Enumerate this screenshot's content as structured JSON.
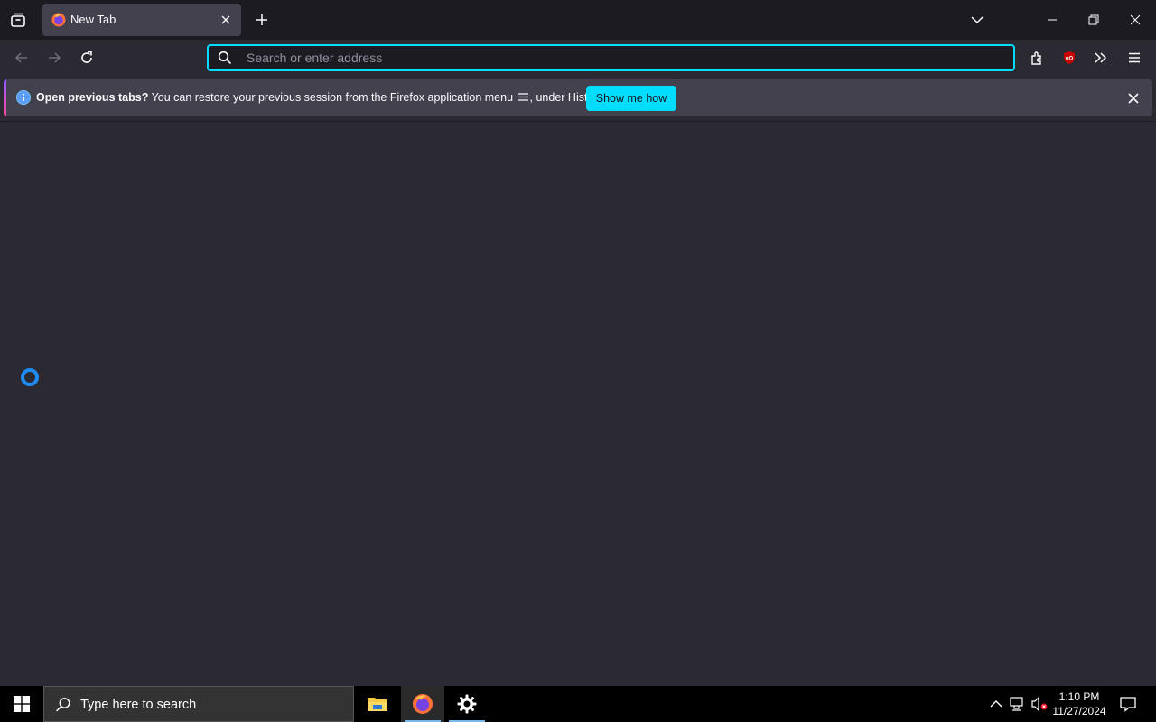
{
  "browser": {
    "tab": {
      "title": "New Tab"
    },
    "urlbar": {
      "placeholder": "Search or enter address",
      "value": ""
    }
  },
  "notification": {
    "bold": "Open previous tabs?",
    "text_before": "You can restore your previous session from the Firefox application menu",
    "text_after": ", under History.",
    "button": "Show me how"
  },
  "taskbar": {
    "search_placeholder": "Type here to search",
    "time": "1:10 PM",
    "date": "11/27/2024"
  },
  "colors": {
    "accent": "#00ddff",
    "spinner": "#1e8cf5",
    "ublock_badge": "#c60000"
  },
  "icons": [
    "tab-list-icon",
    "firefox-icon",
    "close-icon",
    "plus-icon",
    "chevron-down-icon",
    "minimize-icon",
    "restore-icon",
    "back-icon",
    "forward-icon",
    "reload-icon",
    "search-icon",
    "extensions-icon",
    "ublock-icon",
    "overflow-icon",
    "hamburger-menu-icon",
    "info-icon",
    "windows-start-icon",
    "file-explorer-icon",
    "settings-gear-icon",
    "chevron-up-icon",
    "network-icon",
    "volume-muted-icon",
    "notification-center-icon"
  ]
}
